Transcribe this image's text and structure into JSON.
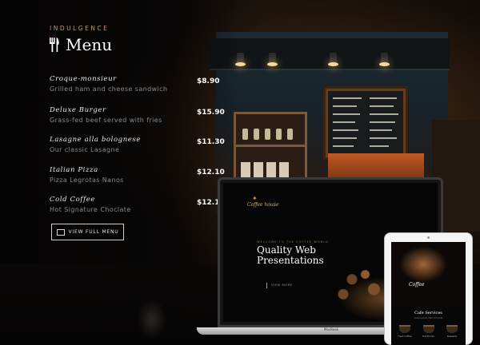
{
  "header": {
    "kicker": "INDULGENCE",
    "title": "Menu",
    "icon": "fork-knife-icon"
  },
  "menu": {
    "items": [
      {
        "name": "Croque-monsieur",
        "description": "Grilled ham and cheese sandwich",
        "price": "$8.90"
      },
      {
        "name": "Deluxe Burger",
        "description": "Grass-fed beef served with fries",
        "price": "$15.90"
      },
      {
        "name": "Lasagne alla bolognese",
        "description": "Our classic Lasagne",
        "price": "$11.30"
      },
      {
        "name": "Italian Pizza",
        "description": "Pizza Legrotas Nanos",
        "price": "$12.10"
      },
      {
        "name": "Cold Coffee",
        "description": "Hot Signature Choclate",
        "price": "$12.10"
      }
    ],
    "view_button_label": "VIEW FULL MENU"
  },
  "laptop": {
    "logo": "Coffee house",
    "kicker": "WELCOME TO THE COFFEE WORLD",
    "headline": "Quality Web Presentations",
    "cta": "VIEW MORE",
    "brand": "MacBook"
  },
  "tablet": {
    "script_text": "Coffee",
    "section_title": "Cafe Services",
    "section_sub": "Lorem ipsum dolor sit amet",
    "cards": [
      "Fresh Coffee",
      "Hot Drinks",
      "Desserts"
    ]
  },
  "colors": {
    "accent": "#c79a5d",
    "background": "#0b0908",
    "text": "#ffffff",
    "muted": "#8a8a8a"
  }
}
